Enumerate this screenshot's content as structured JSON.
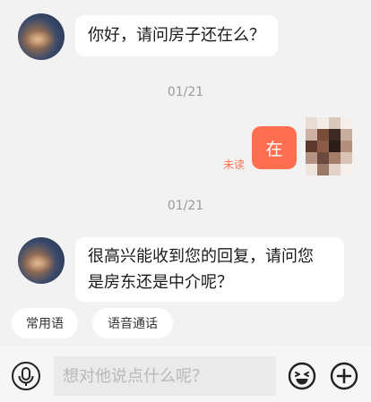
{
  "messages": [
    {
      "direction": "in",
      "text": "你好，请问房子还在么？"
    },
    {
      "timestamp": "01/21"
    },
    {
      "direction": "out",
      "text": "在",
      "status": "未读"
    },
    {
      "timestamp": "01/21"
    },
    {
      "direction": "in",
      "lines": [
        "很高兴能收到您的回复，请问您",
        "是房东还是中介呢？"
      ]
    }
  ],
  "quick_replies": [
    "常用语",
    "语音通话"
  ],
  "input": {
    "placeholder": "想对他说点什么呢？",
    "value": ""
  },
  "icons": {
    "voice": "microphone-icon",
    "emoji": "emoji-icon",
    "more": "plus-icon"
  },
  "colors": {
    "accent": "#ff6f4f",
    "background": "#f2f2f2",
    "bubble_in": "#ffffff"
  }
}
